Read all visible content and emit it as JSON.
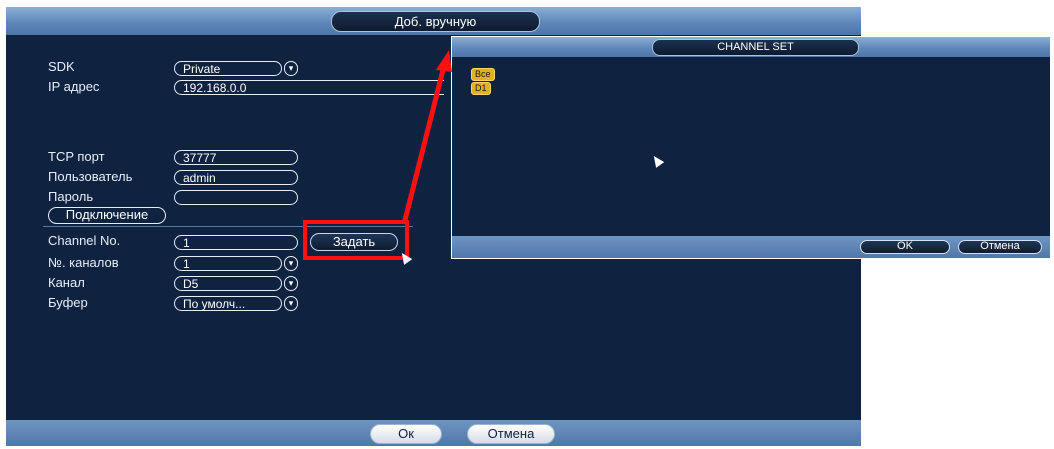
{
  "dialog": {
    "title": "Доб. вручную",
    "ok_label": "Ок",
    "cancel_label": "Отмена"
  },
  "form": {
    "sdk_label": "SDK",
    "sdk_value": "Private",
    "ip_label": "IP адрес",
    "ip_value": "192.168.0.0",
    "tcp_label": "TCP порт",
    "tcp_value": "37777",
    "user_label": "Пользователь",
    "user_value": "admin",
    "password_label": "Пароль",
    "password_value": "",
    "connect_label": "Подключение",
    "channel_no_label": "Channel No.",
    "channel_no_value": "1",
    "set_label": "Задать",
    "channels_count_label": "№. каналов",
    "channels_count_value": "1",
    "channel_label": "Канал",
    "channel_value": "D5",
    "buffer_label": "Буфер",
    "buffer_value": "По умолч..."
  },
  "channel_set": {
    "title": "CHANNEL SET",
    "all_chip": "Все",
    "d1_chip": "D1",
    "ok_label": "OK",
    "cancel_label": "Отмена"
  },
  "colors": {
    "highlight": "#ff1010",
    "panel_bg": "#0f2240",
    "chip": "#e0b21c"
  }
}
